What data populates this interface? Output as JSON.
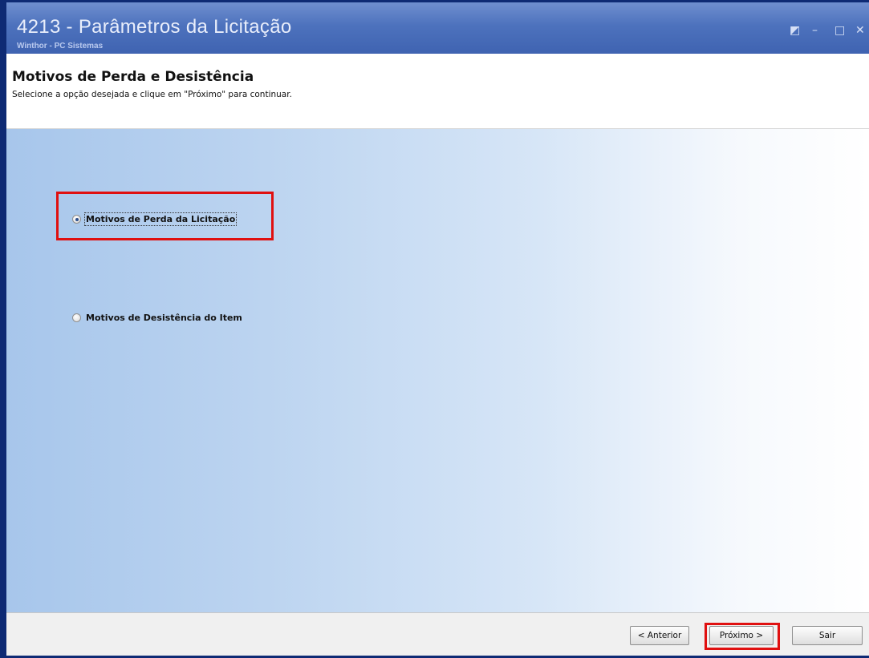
{
  "window": {
    "title": "4213 - Parâmetros da Licitação",
    "subtitle": "Winthor - PC Sistemas",
    "controls": {
      "restore": "◩",
      "minimize": "–",
      "maximize": "□",
      "close": "✕"
    }
  },
  "header": {
    "title": "Motivos de Perda e Desistência",
    "instruction": "Selecione a opção desejada e clique em \"Próximo\" para continuar."
  },
  "options": [
    {
      "label": "Motivos de Perda da Licitação",
      "selected": true
    },
    {
      "label": "Motivos de Desistência do Item",
      "selected": false
    }
  ],
  "footer": {
    "back_label": "< Anterior",
    "next_label": "Próximo >",
    "exit_label": "Sair"
  },
  "colors": {
    "titlebar": "#4d72bd",
    "highlight": "#e01010",
    "window_border": "#0e2a74"
  }
}
